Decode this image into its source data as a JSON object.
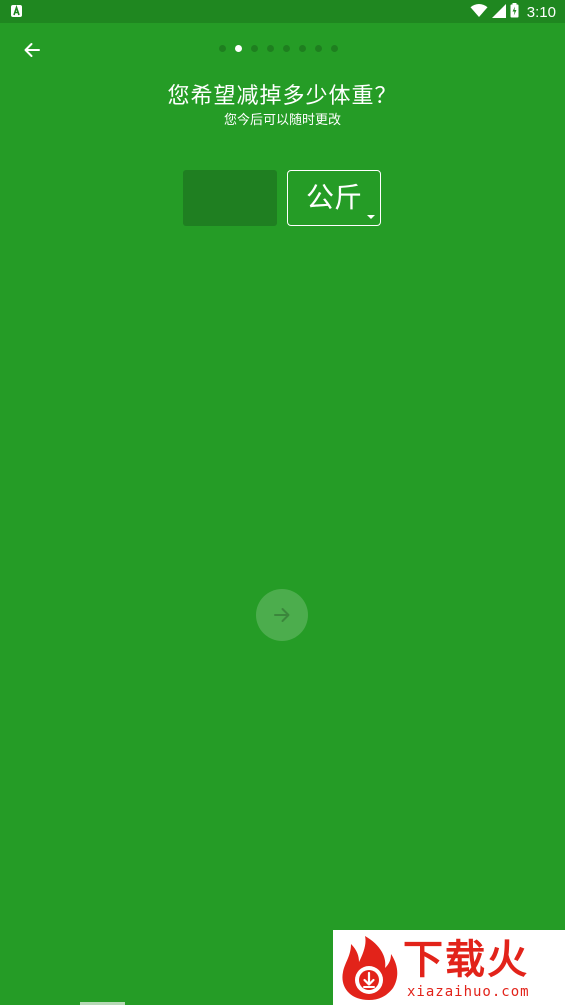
{
  "status_bar": {
    "time": "3:10",
    "left_icon": "notification-a-icon",
    "icons": [
      "wifi-icon",
      "cell-signal-icon",
      "battery-charging-icon"
    ]
  },
  "nav": {
    "back_icon": "arrow-left-icon",
    "page_count": 8,
    "active_page": 2
  },
  "header": {
    "title": "您希望减掉多少体重？",
    "subtitle": "您今后可以随时更改"
  },
  "form": {
    "weight_value": "",
    "unit_selected": "公斤"
  },
  "next_button": {
    "icon": "arrow-right-icon",
    "enabled": false
  },
  "watermark": {
    "brand": "下载火",
    "url": "xiazaihuo.com"
  },
  "colors": {
    "background": "#259c26",
    "status_bar": "#1f8720",
    "input_bg": "#1f7f21",
    "watermark_red": "#e2231a"
  }
}
